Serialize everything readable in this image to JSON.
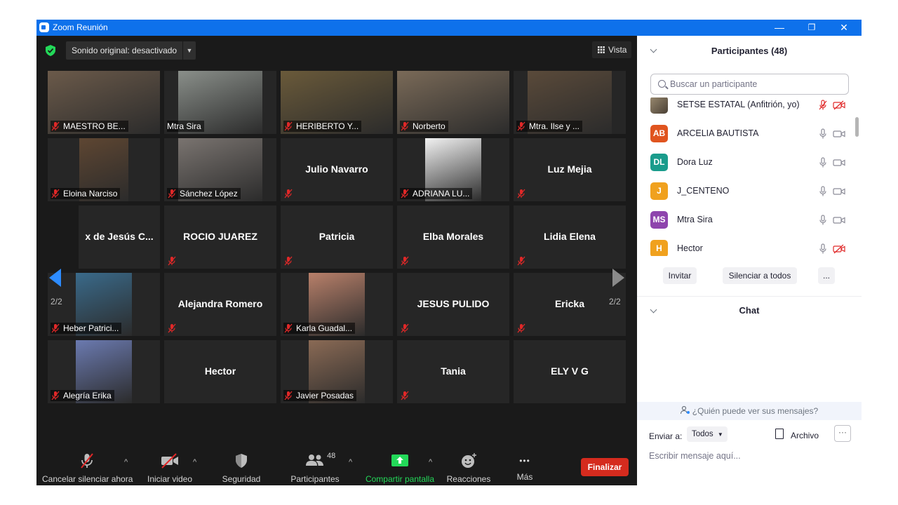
{
  "window": {
    "title": "Zoom Reunión",
    "minimize": "—",
    "restore": "❐",
    "close": "✕"
  },
  "topbar": {
    "sound_label": "Sonido original: desactivado",
    "view_label": "Vista"
  },
  "grid": {
    "page_indicator_left": "2/2",
    "page_indicator_right": "2/2",
    "tiles": [
      {
        "name": "MAESTRO BE...",
        "has_video": true,
        "muted": true
      },
      {
        "name": "Mtra Sira",
        "has_video": true,
        "muted": false
      },
      {
        "name": "HERIBERTO Y...",
        "has_video": true,
        "muted": true
      },
      {
        "name": "Norberto",
        "has_video": true,
        "muted": true
      },
      {
        "name": "Mtra. Ilse y ...",
        "has_video": true,
        "muted": true
      },
      {
        "name": "Eloina Narciso",
        "has_video": true,
        "muted": true
      },
      {
        "name": "Sánchez López",
        "has_video": true,
        "muted": true
      },
      {
        "name": "Julio Navarro",
        "has_video": false,
        "muted": true
      },
      {
        "name": "ADRIANA LU...",
        "has_video": true,
        "muted": true
      },
      {
        "name": "Luz Mejia",
        "has_video": false,
        "muted": true
      },
      {
        "name": "x de Jesús C...",
        "has_video": false,
        "muted": false
      },
      {
        "name": "ROCIO JUAREZ",
        "has_video": false,
        "muted": true
      },
      {
        "name": "Patricia",
        "has_video": false,
        "muted": true
      },
      {
        "name": "Elba Morales",
        "has_video": false,
        "muted": true
      },
      {
        "name": "Lidia Elena",
        "has_video": false,
        "muted": true
      },
      {
        "name": "Heber Patrici...",
        "has_video": true,
        "muted": true
      },
      {
        "name": "Alejandra Romero",
        "has_video": false,
        "muted": true
      },
      {
        "name": "Karla Guadal...",
        "has_video": true,
        "muted": true
      },
      {
        "name": "JESUS PULIDO",
        "has_video": false,
        "muted": true
      },
      {
        "name": "Ericka",
        "has_video": false,
        "muted": true
      },
      {
        "name": "Alegría Erika",
        "has_video": true,
        "muted": true
      },
      {
        "name": "Hector",
        "has_video": false,
        "muted": false
      },
      {
        "name": "Javier Posadas",
        "has_video": true,
        "muted": true
      },
      {
        "name": "Tania",
        "has_video": false,
        "muted": true
      },
      {
        "name": "ELY V G",
        "has_video": false,
        "muted": false
      }
    ]
  },
  "toolbar": {
    "unmute": "Cancelar silenciar ahora",
    "video": "Iniciar video",
    "security": "Seguridad",
    "participants": "Participantes",
    "participants_count": "48",
    "share": "Compartir pantalla",
    "reactions": "Reacciones",
    "more": "Más",
    "end": "Finalizar",
    "more_dots": "•••"
  },
  "panel": {
    "title": "Participantes (48)",
    "search_placeholder": "Buscar un participante",
    "participants": [
      {
        "name": "SETSE ESTATAL (Anfitrión, yo)",
        "initials": "",
        "color": "#7a6a55",
        "mic_muted": true,
        "cam_off": true
      },
      {
        "name": "ARCELIA BAUTISTA",
        "initials": "AB",
        "color": "#e0541f",
        "mic_muted": false,
        "cam_off": false
      },
      {
        "name": "Dora Luz",
        "initials": "DL",
        "color": "#1a9c8c",
        "mic_muted": false,
        "cam_off": false
      },
      {
        "name": "J_CENTENO",
        "initials": "J",
        "color": "#f0a11e",
        "mic_muted": false,
        "cam_off": false
      },
      {
        "name": "Mtra Sira",
        "initials": "MS",
        "color": "#8e44ad",
        "mic_muted": false,
        "cam_off": false
      },
      {
        "name": "Hector",
        "initials": "H",
        "color": "#f0a11e",
        "mic_muted": false,
        "cam_off": true
      }
    ],
    "invite": "Invitar",
    "mute_all": "Silenciar a todos",
    "more": "...",
    "chat_title": "Chat",
    "who_can_see": "¿Quién puede ver sus mensajes?",
    "send_to_label": "Enviar a:",
    "send_to_value": "Todos",
    "file": "Archivo",
    "file_more": "···",
    "message_placeholder": "Escribir mensaje aquí..."
  },
  "colors": {
    "accent": "#0e71eb",
    "end": "#d52b1e",
    "share": "#23d959",
    "muted_icon": "#e02828"
  }
}
